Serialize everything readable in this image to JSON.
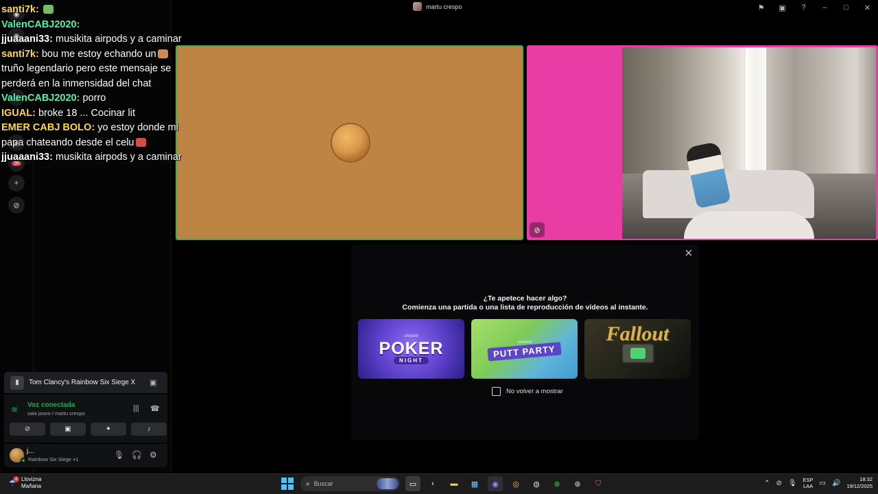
{
  "window": {
    "title": "martu crespo"
  },
  "chat": {
    "lines": [
      {
        "user": "santi7k:",
        "user_color": "#ffd84a",
        "message": ""
      },
      {
        "user": "ValenCABJ2020:",
        "user_color": "#4ef2b0",
        "message": ""
      },
      {
        "user": "jjuaaani33:",
        "user_color": "#ffffff",
        "message": "musikita airpods y a caminar"
      },
      {
        "user": "santi7k:",
        "user_color": "#ffd84a",
        "message": "bou me estoy echando un"
      },
      {
        "user": "",
        "user_color": "#ffffff",
        "message": "truño legendario pero este mensaje se"
      },
      {
        "user": "",
        "user_color": "#ffffff",
        "message": "perderá en la inmensidad del chat"
      },
      {
        "user": "ValenCABJ2020:",
        "user_color": "#4ef2b0",
        "message": "porro"
      },
      {
        "user": "IGUAL:",
        "user_color": "#ffd84a",
        "message": "broke 18 ... Cocinar lit"
      },
      {
        "user": "EMER CABJ BOLO:",
        "user_color": "#ffd84a",
        "message": "yo estoy donde mi"
      },
      {
        "user": "",
        "user_color": "#ffffff",
        "message": "papa chateando desde el celu"
      },
      {
        "user": "jjuaaani33:",
        "user_color": "#ffffff",
        "message": "musikita airpods y a caminar"
      }
    ]
  },
  "activity": {
    "title": "¿Te apetece hacer algo?",
    "subtitle": "Comienza una partida o una lista de reproducción de vídeos al instante.",
    "cards": [
      {
        "badge": "Discord",
        "name": "POKER",
        "sub": "NIGHT"
      },
      {
        "badge": "Discord",
        "name": "PUTT PARTY",
        "sub": ""
      },
      {
        "badge": "",
        "name": "Fallout",
        "sub": ""
      }
    ],
    "dont_show_label": "No volver a mostrar"
  },
  "game": {
    "name": "Tom Clancy's Rainbow Six Siege X"
  },
  "voice": {
    "status": "Voz conectada",
    "channel": "sala joseo / martu crespo"
  },
  "user": {
    "name": "j...",
    "activity": "Rainbow Six Siege +1"
  },
  "taskbar": {
    "weather_badge": "4",
    "weather_line1": "Llovizna",
    "weather_line2": "Mañana",
    "search_placeholder": "Buscar",
    "lang_line1": "ESP",
    "lang_line2": "LAA",
    "time": "18:32",
    "date": "19/12/2025",
    "rail_badge": "36"
  },
  "colors": {
    "speaking_border": "#3ca95b",
    "tile_left_bg": "#bd8444",
    "tile_right_bg": "#e83ea3",
    "voice_green": "#23a55a"
  }
}
